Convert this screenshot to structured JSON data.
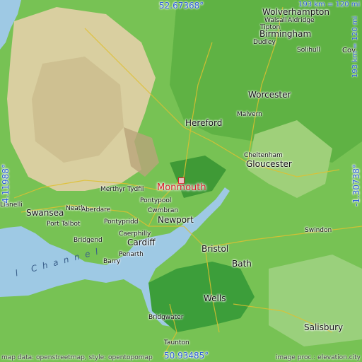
{
  "map": {
    "selected_place": "Monmouth",
    "places": [
      {
        "name": "Wolverhampton",
        "size": "big"
      },
      {
        "name": "Walsall"
      },
      {
        "name": "Aldridge",
        "size": "tiny"
      },
      {
        "name": "Tipton",
        "size": "tiny"
      },
      {
        "name": "Birmingham",
        "size": "big"
      },
      {
        "name": "Dudley",
        "size": "tiny"
      },
      {
        "name": "Solihull",
        "size": "tiny"
      },
      {
        "name": "Cov"
      },
      {
        "name": "Worcester",
        "size": "big"
      },
      {
        "name": "Malvern",
        "size": "tiny"
      },
      {
        "name": "Hereford",
        "size": "big"
      },
      {
        "name": "Cheltenham",
        "size": "tiny"
      },
      {
        "name": "Gloucester",
        "size": "big"
      },
      {
        "name": "Merthyr Tydfil",
        "size": "tiny"
      },
      {
        "name": "Pontypool",
        "size": "tiny"
      },
      {
        "name": "Neath",
        "size": "tiny"
      },
      {
        "name": "Aberdare",
        "size": "tiny"
      },
      {
        "name": "Cwmbran",
        "size": "tiny"
      },
      {
        "name": "Llanelli",
        "size": "tiny"
      },
      {
        "name": "Swansea",
        "size": "big"
      },
      {
        "name": "Port Talbot",
        "size": "tiny"
      },
      {
        "name": "Pontypridd",
        "size": "tiny"
      },
      {
        "name": "Newport",
        "size": "big"
      },
      {
        "name": "Caerphilly",
        "size": "tiny"
      },
      {
        "name": "Bridgend",
        "size": "tiny"
      },
      {
        "name": "Cardiff",
        "size": "big"
      },
      {
        "name": "Penarth",
        "size": "tiny"
      },
      {
        "name": "Barry",
        "size": "tiny"
      },
      {
        "name": "Swindon",
        "size": "tiny"
      },
      {
        "name": "Bristol",
        "size": "big"
      },
      {
        "name": "Bath",
        "size": "big"
      },
      {
        "name": "Wells",
        "size": "big"
      },
      {
        "name": "Bridgwater",
        "size": "tiny"
      },
      {
        "name": "Salisbury",
        "size": "big"
      },
      {
        "name": "Taunton",
        "size": "tiny"
      }
    ],
    "sea_label": "l Channel",
    "coords": {
      "north": "52.67368°",
      "south": "50.93485°",
      "west": "-4.11988°",
      "east": "-1.30738°"
    },
    "scale": {
      "horizontal": "193 km = 120 mi",
      "vertical": "193 km = 120 mi"
    },
    "credits": {
      "left": "map data: openstreetmap, style: opentopomap",
      "right": "image proc.: elevation.city"
    },
    "colors": {
      "sea": "#9ec9e4",
      "lowland": "#6bbf48",
      "upland": "#d8cfa0",
      "selected": "#d61f2a",
      "coordinate_text": "#2d5fd9"
    }
  }
}
